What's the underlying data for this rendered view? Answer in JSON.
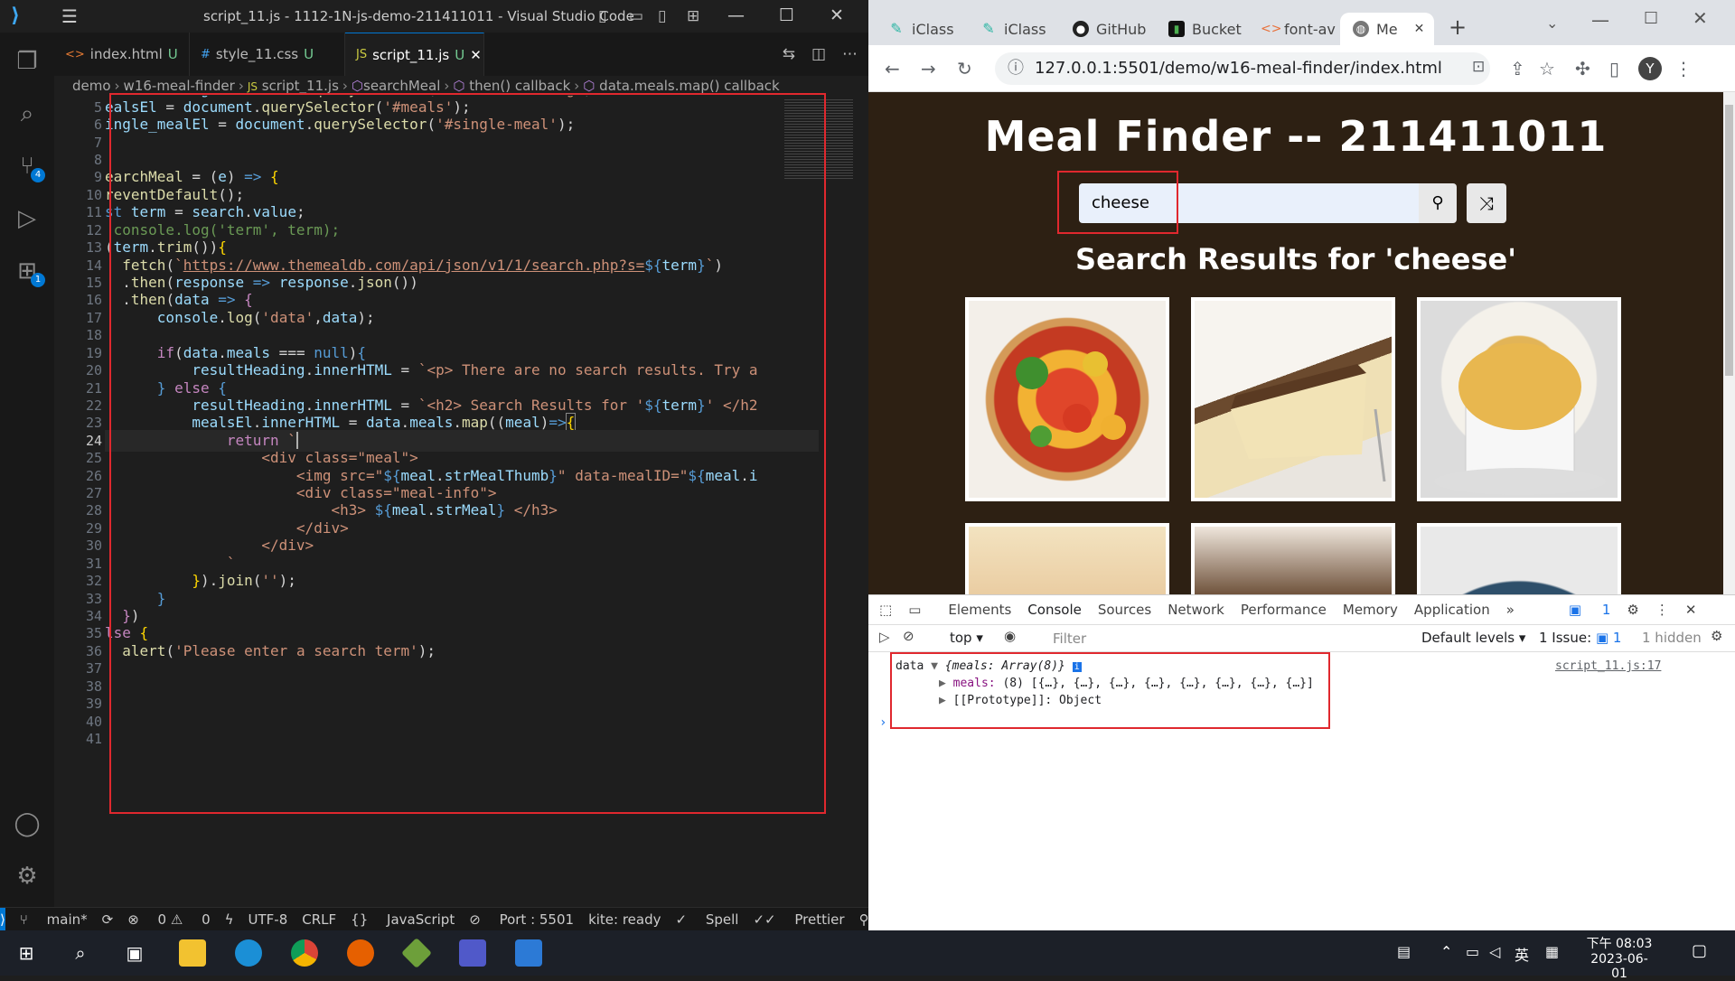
{
  "vscode": {
    "title": "script_11.js - 1112-1N-js-demo-211411011 - Visual Studio Code",
    "tabs": [
      {
        "label": "index.html",
        "icon": "<>",
        "status": "U"
      },
      {
        "label": "style_11.css",
        "icon": "#",
        "status": "U"
      },
      {
        "label": "script_11.js",
        "icon": "JS",
        "status": "U"
      }
    ],
    "breadcrumb": [
      "demo",
      "w16-meal-finder",
      "script_11.js",
      "searchMeal",
      "then() callback",
      "data.meals.map() callback"
    ],
    "activity_badges": {
      "source_control": "4",
      "extensions": "1"
    },
    "status": {
      "branch": "main*",
      "errors": "0",
      "warnings": "0",
      "encoding": "UTF-8",
      "eol": "CRLF",
      "language": "JavaScript",
      "port": "Port : 5501",
      "kite": "kite: ready",
      "spell": "Spell",
      "prettier": "Prettier"
    },
    "current_line": 24
  },
  "chrome": {
    "tabs": [
      "iClass",
      "iClass",
      "GitHub",
      "Bucket",
      "font-av",
      "Me"
    ],
    "url": "127.0.0.1:5501/demo/w16-meal-finder/index.html",
    "profile": "Y",
    "page": {
      "title": "Meal Finder -- 211411011",
      "search_value": "cheese",
      "results_heading": "Search Results for 'cheese'"
    },
    "devtools": {
      "tabs": [
        "Elements",
        "Console",
        "Sources",
        "Network",
        "Performance",
        "Memory",
        "Application"
      ],
      "messages_badge": "1",
      "context": "top",
      "filter_placeholder": "Filter",
      "levels": "Default levels",
      "issues": "1 Issue:",
      "issues_count": "1",
      "hidden": "1 hidden",
      "log_label": "data",
      "log_object": "{meals: Array(8)}",
      "log_meals_key": "meals:",
      "log_meals_val": "(8) [{…}, {…}, {…}, {…}, {…}, {…}, {…}, {…}]",
      "log_proto": "[[Prototype]]: Object",
      "log_source": "script_11.js:17"
    }
  },
  "taskbar": {
    "time": "下午 08:03",
    "date": "2023-06-01",
    "ime": "英"
  }
}
